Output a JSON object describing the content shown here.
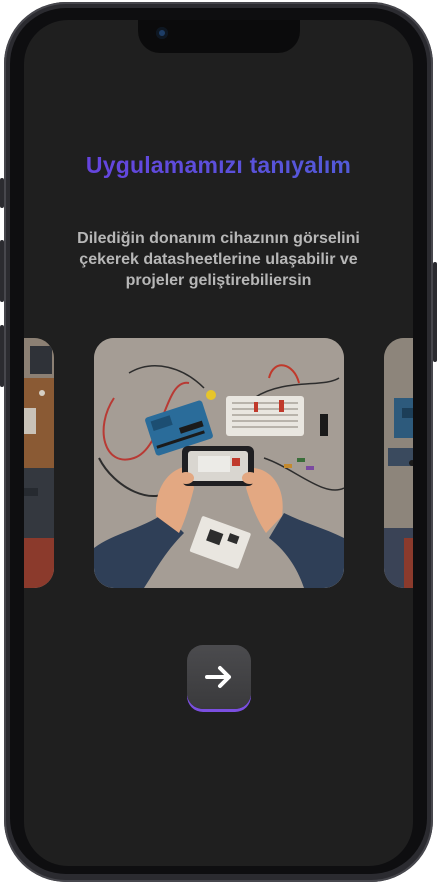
{
  "onboarding": {
    "title": "Uygulamamızı tanıyalım",
    "subtitle": "Dilediğin donanım cihazının görselini çekerek datasheetlerine ulaşabilir ve projeler geliştirebiliersin"
  },
  "carousel": {
    "slides": [
      {
        "icon": "workbench-illustration"
      },
      {
        "icon": "hands-phone-scanning-arduino-illustration"
      },
      {
        "icon": "circuit-board-illustration"
      }
    ]
  },
  "next_button": {
    "icon": "arrow-right-icon"
  },
  "colors": {
    "screen_bg": "#1f1f1f",
    "title_gradient_start": "#6a3fe0",
    "title_gradient_end": "#4e5fd6",
    "subtitle": "#b7b7b7",
    "button_bg": "#434345",
    "button_accent": "#7b4fe0"
  }
}
